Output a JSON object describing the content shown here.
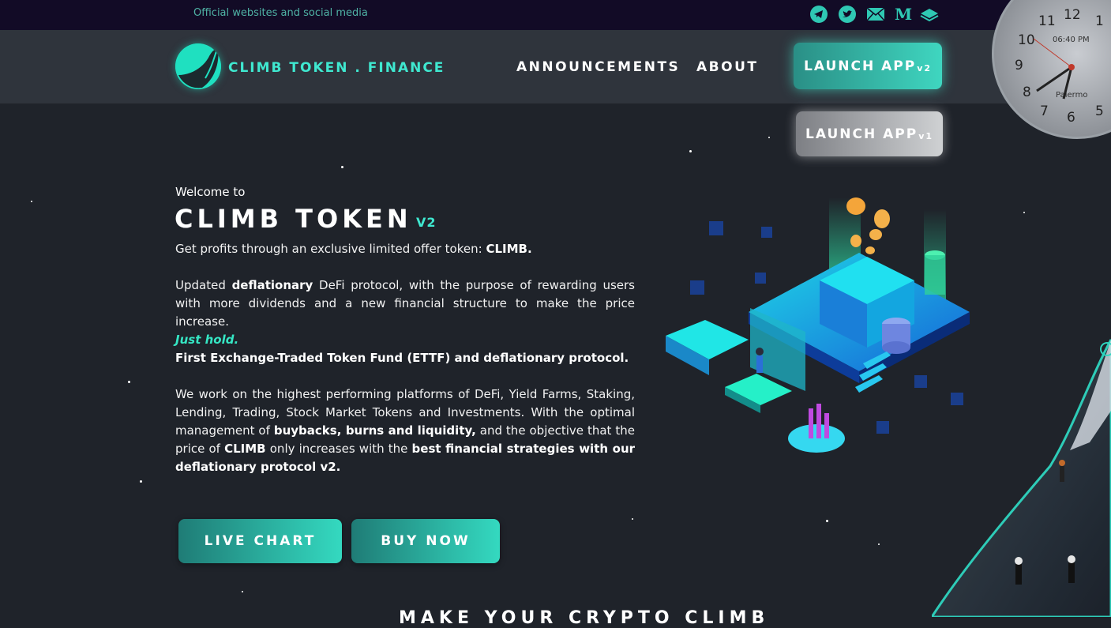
{
  "topbar": {
    "text": "Official websites and social media",
    "social_icons": [
      "telegram-icon",
      "twitter-icon",
      "email-icon",
      "medium-icon",
      "gitbook-icon"
    ],
    "medium_glyph": "M"
  },
  "navbar": {
    "logo_text": "CLIMB TOKEN . FINANCE",
    "links": [
      "ANNOUNCEMENTS",
      "ABOUT"
    ],
    "launch_v2": {
      "label": "LAUNCH APP",
      "version": "v2"
    },
    "launch_v1": {
      "label": "LAUNCH APP",
      "version": "v1"
    }
  },
  "clock": {
    "time": "06:40 PM",
    "city": "Palermo",
    "numerals": [
      "12",
      "11",
      "1",
      "10",
      "9",
      "8",
      "7",
      "6",
      "5"
    ]
  },
  "hero": {
    "welcome": "Welcome to",
    "title": "CLIMB TOKEN",
    "title_version": "V2",
    "p1_text": "Get profits through an exclusive limited offer token: ",
    "p1_bold": "CLIMB.",
    "p2_a": "Updated ",
    "p2_bold": "deflationary",
    "p2_b": " DeFi protocol, with the purpose of rewarding users with more dividends and a new financial structure to make the price increase.",
    "just_hold": "Just hold.",
    "ettf": "First Exchange-Traded Token Fund (ETTF) and deflationary protocol.",
    "p3_a": "We work on the highest performing platforms of DeFi, Yield Farms, Staking, Lending, Trading, Stock Market Tokens and Investments. With the optimal management of ",
    "p3_bold1": "buybacks, burns and liquidity,",
    "p3_b": " and the objective that the price of ",
    "p3_bold2": "CLIMB",
    "p3_c": " only increases with the ",
    "p3_bold3": "best financial strategies with our deflationary protocol v2."
  },
  "buttons": {
    "live_chart": "LIVE CHART",
    "buy_now": "BUY NOW"
  },
  "section": {
    "heading": "MAKE YOUR CRYPTO CLIMB"
  },
  "colors": {
    "accent": "#3fe8d0",
    "background": "#1f232a",
    "navbar": "#2f343c",
    "topbar": "#120b26"
  }
}
